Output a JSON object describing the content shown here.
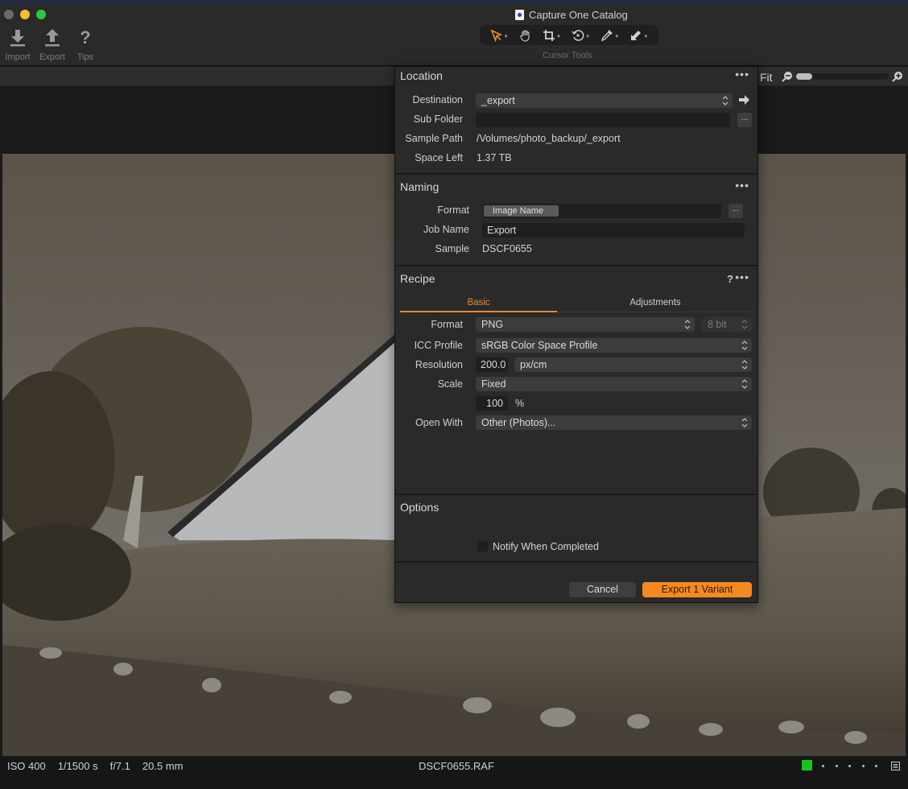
{
  "window": {
    "title": "Capture One Catalog"
  },
  "toolbar": {
    "import_label": "Import",
    "export_label": "Export",
    "tips_label": "Tips",
    "cursor_tools_label": "Cursor Tools",
    "cursor_tools": [
      {
        "name": "select",
        "icon": "pointer-arrow-icon",
        "active": true
      },
      {
        "name": "pan",
        "icon": "hand-icon",
        "active": false
      },
      {
        "name": "crop",
        "icon": "crop-icon",
        "active": false
      },
      {
        "name": "rotate",
        "icon": "rotate-icon",
        "active": false
      },
      {
        "name": "picker",
        "icon": "eyedropper-icon",
        "active": false
      },
      {
        "name": "annotate",
        "icon": "brush-arrow-icon",
        "active": false
      }
    ],
    "accent_color": "#e88a2c"
  },
  "viewer": {
    "zoom_label": "Fit",
    "zoom_level": 0.05
  },
  "dialog": {
    "location": {
      "title": "Location",
      "destination_label": "Destination",
      "destination_value": "_export",
      "subfolder_label": "Sub Folder",
      "subfolder_value": "",
      "subfolder_button": "...",
      "sample_path_label": "Sample Path",
      "sample_path_value": "/Volumes/photo_backup/_export",
      "space_left_label": "Space Left",
      "space_left_value": "1.37 TB"
    },
    "naming": {
      "title": "Naming",
      "format_label": "Format",
      "format_token": "Image Name",
      "format_button": "...",
      "job_name_label": "Job Name",
      "job_name_value": "Export",
      "sample_label": "Sample",
      "sample_value": "DSCF0655"
    },
    "recipe": {
      "title": "Recipe",
      "help": "?",
      "tabs": [
        {
          "label": "Basic",
          "active": true
        },
        {
          "label": "Adjustments",
          "active": false
        }
      ],
      "format_label": "Format",
      "format_value": "PNG",
      "bit_depth_value": "8 bit",
      "icc_label": "ICC Profile",
      "icc_value": "sRGB Color Space Profile",
      "resolution_label": "Resolution",
      "resolution_value": "200.0",
      "resolution_unit": "px/cm",
      "scale_label": "Scale",
      "scale_value": "Fixed",
      "scale_percent_value": "100",
      "scale_percent_unit": "%",
      "open_with_label": "Open With",
      "open_with_value": "Other (Photos)..."
    },
    "options": {
      "title": "Options",
      "notify_label": "Notify When Completed",
      "notify_checked": false
    },
    "cancel_label": "Cancel",
    "export_label": "Export 1 Variant",
    "export_color": "#f6891f"
  },
  "statusbar": {
    "iso": "ISO 400",
    "shutter": "1/1500 s",
    "aperture": "f/7.1",
    "focal_length": "20.5 mm",
    "filename": "DSCF0655.RAF",
    "color_tag": "#17c517",
    "rating": 0,
    "rating_max": 5
  }
}
